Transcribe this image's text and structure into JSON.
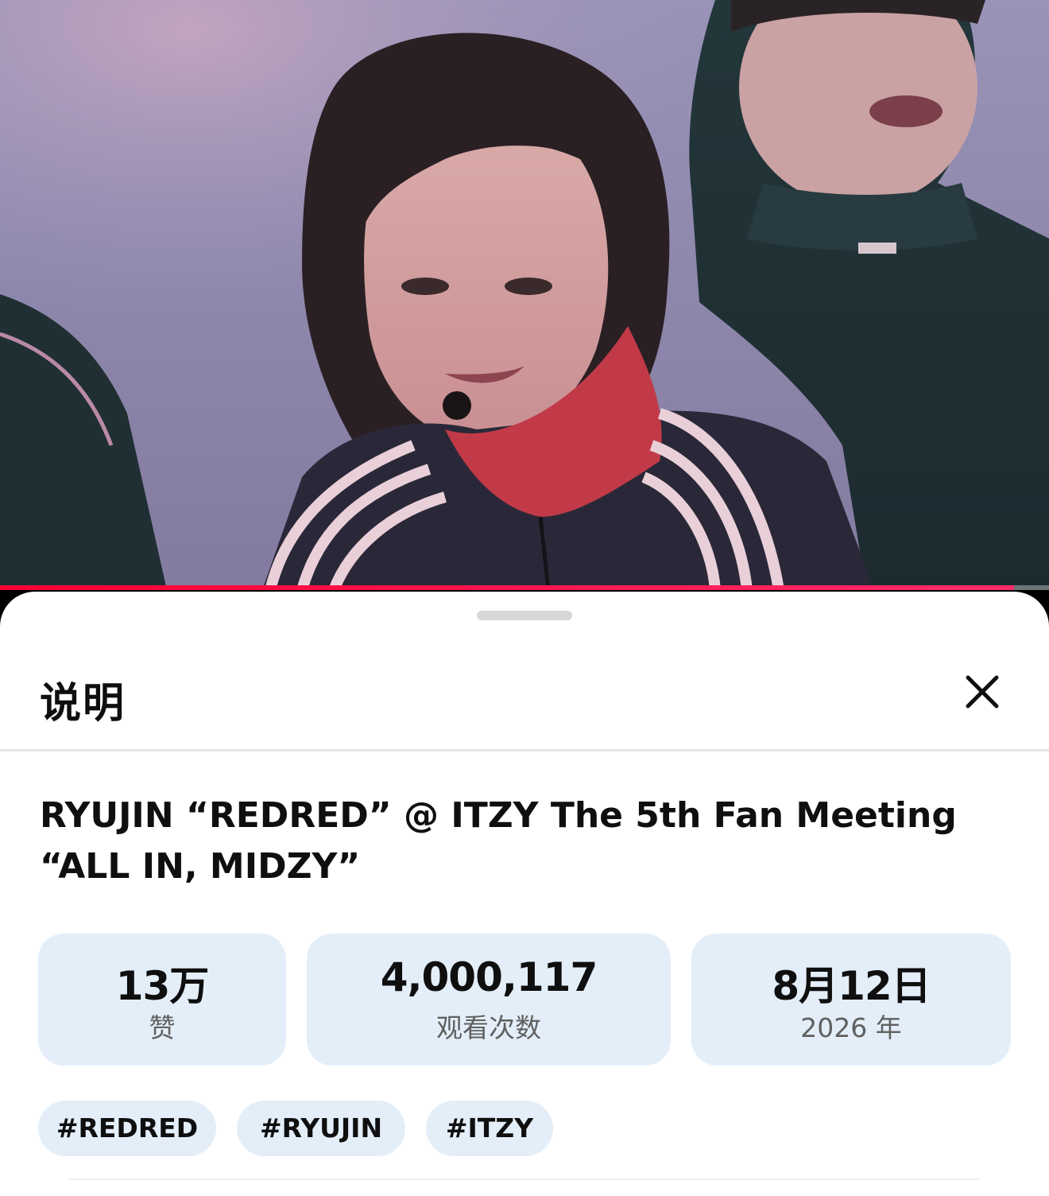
{
  "player": {
    "progress_fraction": 0.967,
    "progress_color": "#ff0033"
  },
  "sheet": {
    "title": "说明",
    "close_icon": "close-icon"
  },
  "video": {
    "title": "RYUJIN “REDRED” @ ITZY The 5th Fan Meeting “ALL IN, MIDZY”"
  },
  "stats": [
    {
      "value": "13万",
      "label": "赞"
    },
    {
      "value": "4,000,117",
      "label": "观看次数"
    },
    {
      "value": "8月12日",
      "label": "2026 年"
    }
  ],
  "tags": [
    "#REDRED",
    "#RYUJIN",
    "#ITZY"
  ],
  "colors": {
    "chip_bg": "#e3eef9",
    "text_primary": "#0f0f0f",
    "text_secondary": "#606060"
  }
}
